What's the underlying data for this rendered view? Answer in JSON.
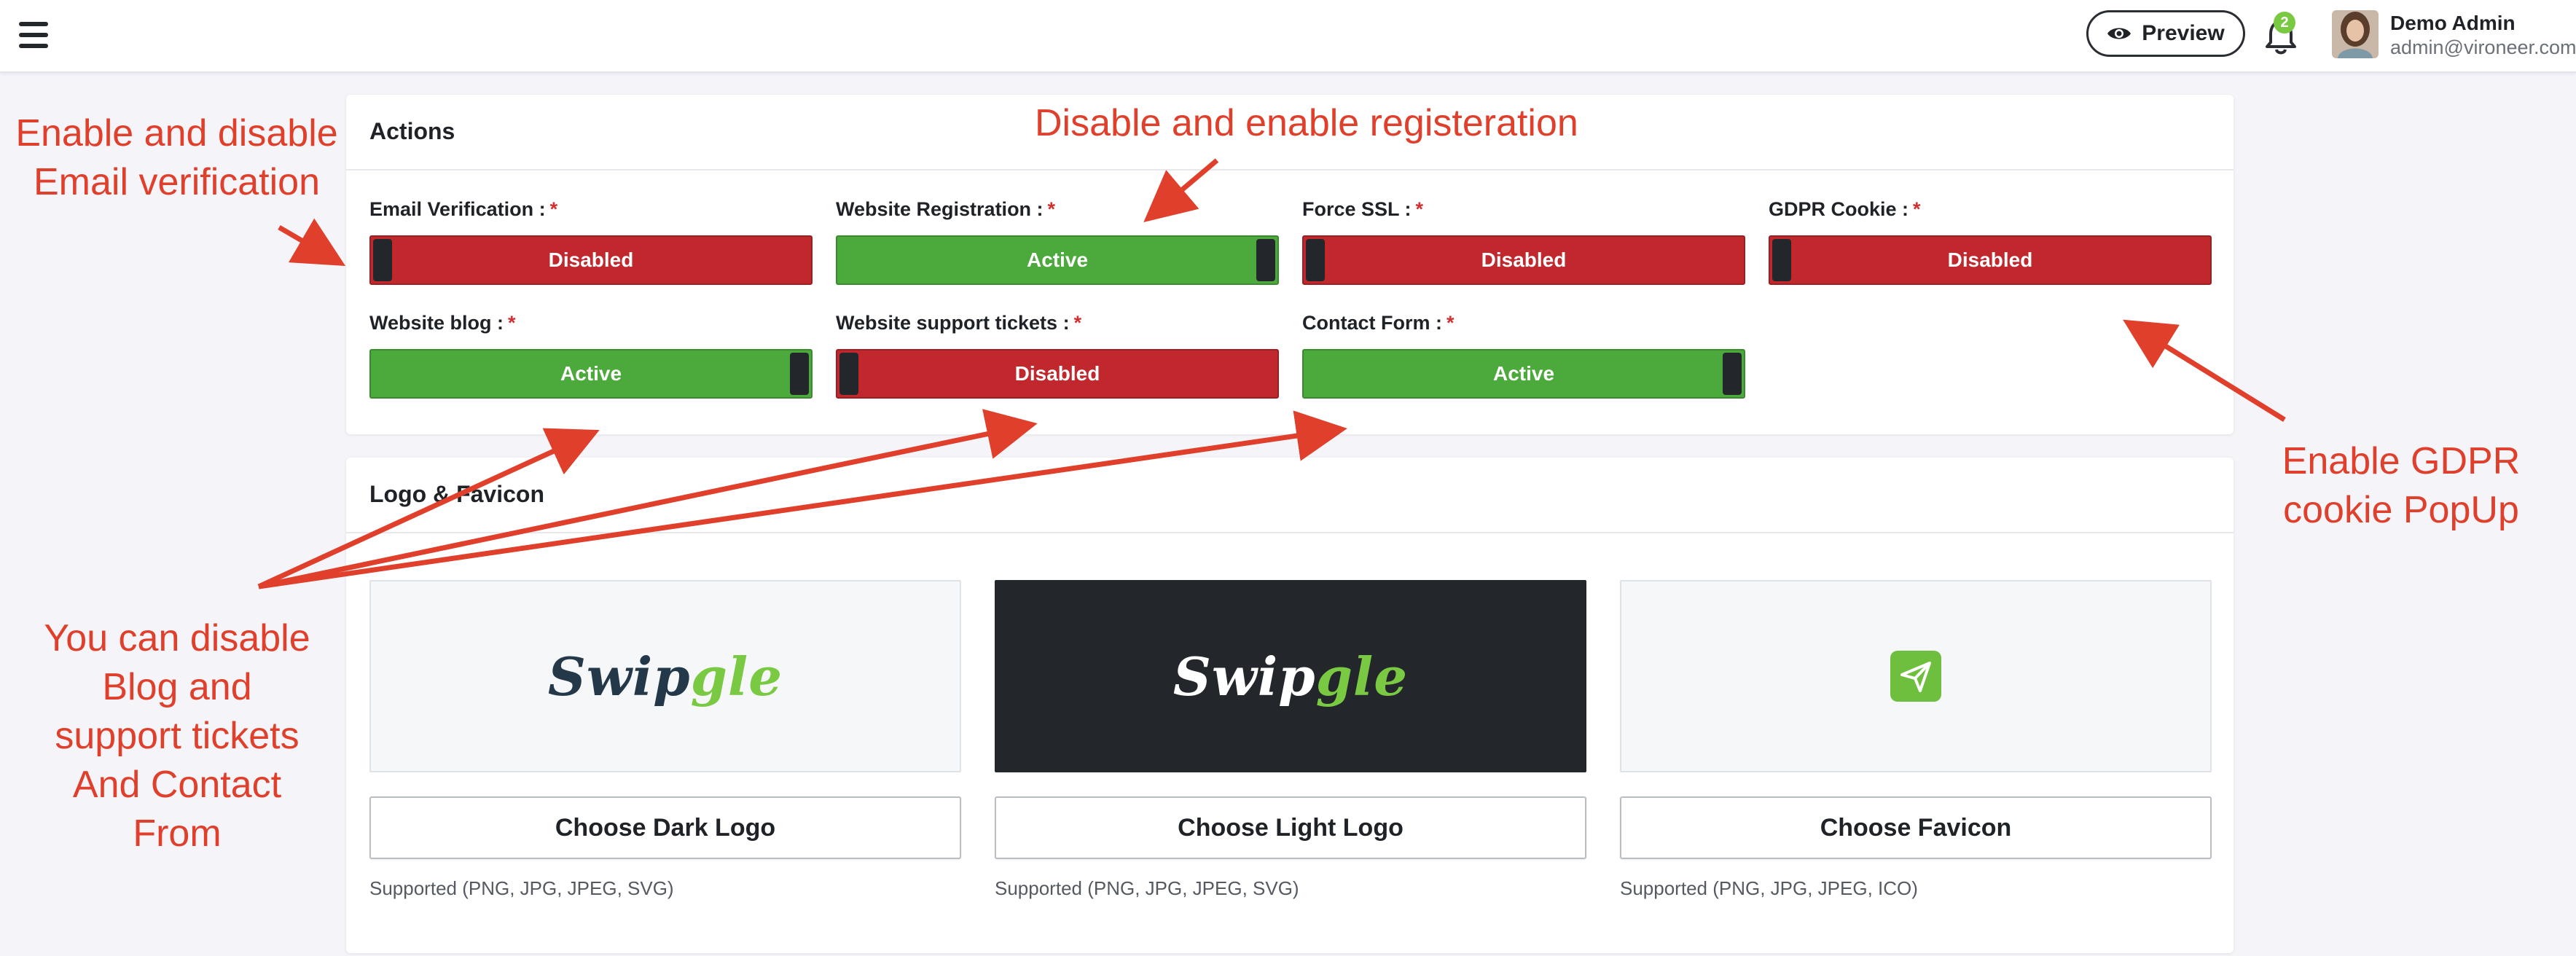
{
  "topbar": {
    "preview_label": "Preview",
    "notification_count": "2",
    "user_name": "Demo Admin",
    "user_email": "admin@vironeer.com"
  },
  "actions": {
    "title": "Actions",
    "fields": [
      {
        "label": "Email Verification :",
        "status": "Disabled",
        "state": "off"
      },
      {
        "label": "Website Registration :",
        "status": "Active",
        "state": "on"
      },
      {
        "label": "Force SSL :",
        "status": "Disabled",
        "state": "off"
      },
      {
        "label": "GDPR Cookie :",
        "status": "Disabled",
        "state": "off"
      },
      {
        "label": "Website blog :",
        "status": "Active",
        "state": "on"
      },
      {
        "label": "Website support tickets :",
        "status": "Disabled",
        "state": "off"
      },
      {
        "label": "Contact Form :",
        "status": "Active",
        "state": "on"
      }
    ],
    "required_mark": "*"
  },
  "logo": {
    "title": "Logo & Favicon",
    "brand_prefix": "Swip",
    "brand_suffix": "gle",
    "items": [
      {
        "button": "Choose Dark Logo",
        "supported": "Supported (PNG, JPG, JPEG, SVG)"
      },
      {
        "button": "Choose Light Logo",
        "supported": "Supported (PNG, JPG, JPEG, SVG)"
      },
      {
        "button": "Choose Favicon",
        "supported": "Supported (PNG, JPG, JPEG, ICO)"
      }
    ]
  },
  "annotations": {
    "email_line1": "Enable and disable",
    "email_line2": "Email verification",
    "registration": "Disable and enable registeration",
    "gdpr_line1": "Enable GDPR",
    "gdpr_line2": "cookie PopUp",
    "blog_line1": "You can disable",
    "blog_line2": "Blog and",
    "blog_line3": "support tickets",
    "blog_line4": "And Contact",
    "blog_line5": "From"
  },
  "colors": {
    "disabled": "#c0282d",
    "active": "#4caa3c",
    "annotation": "#e0402b",
    "brand_green": "#7ac943",
    "brand_dark": "#23394a"
  }
}
